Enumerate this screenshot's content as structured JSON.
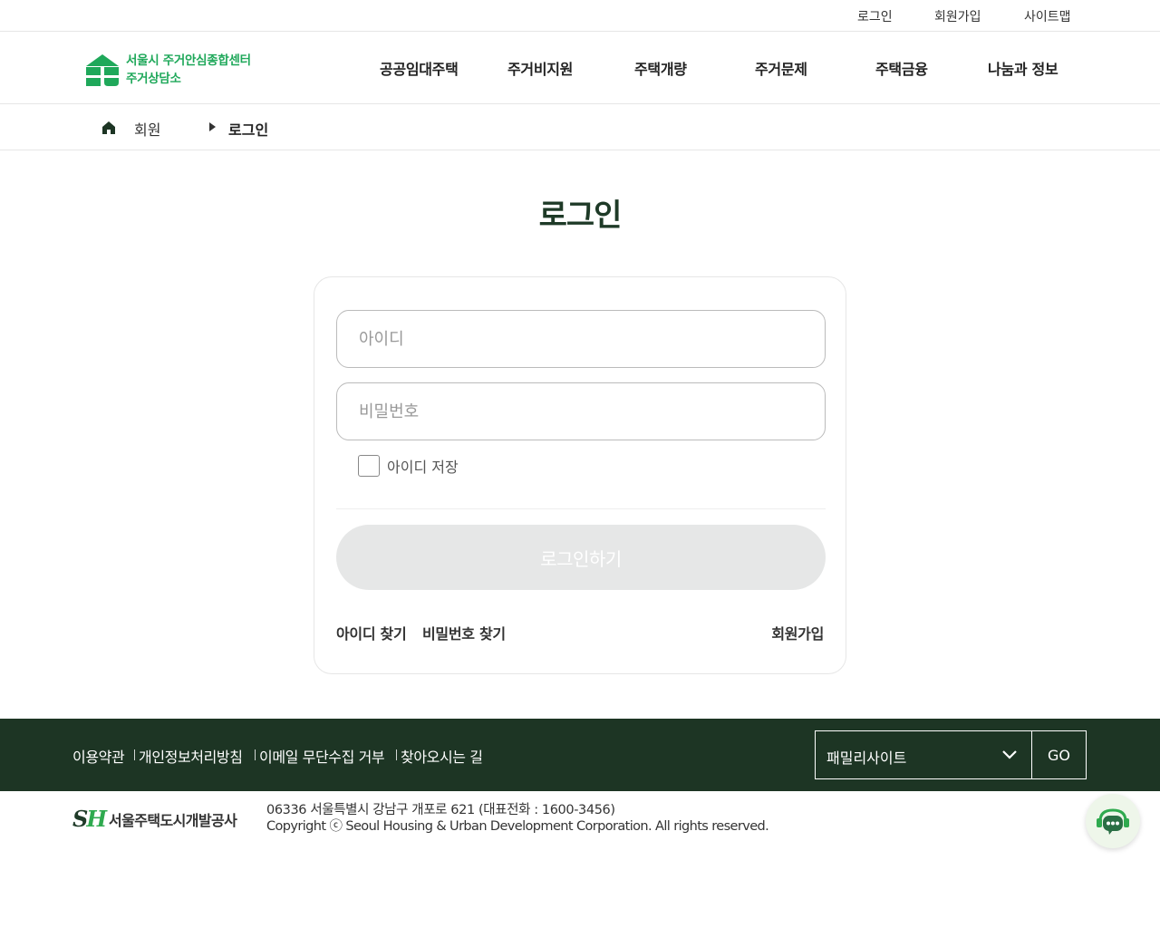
{
  "util_nav": {
    "login": "로그인",
    "signup": "회원가입",
    "sitemap": "사이트맵"
  },
  "logo": {
    "line1": "서울시 주거안심종합센터",
    "line2": "주거상담소"
  },
  "gnb": [
    "공공임대주택",
    "주거비지원",
    "주택개량",
    "주거문제",
    "주택금융",
    "나눔과 정보"
  ],
  "breadcrumb": {
    "parent": "회원",
    "current": "로그인"
  },
  "page_title": "로그인",
  "login_form": {
    "id_placeholder": "아이디",
    "id_value": "",
    "password_placeholder": "비밀번호",
    "password_value": "",
    "remember_label": "아이디 저장",
    "remember_checked": false,
    "submit_label": "로그인하기",
    "find_id": "아이디 찾기",
    "find_password": "비밀번호 찾기",
    "signup": "회원가입"
  },
  "footer": {
    "links": [
      "이용약관",
      "개인정보처리방침",
      "이메일 무단수집 거부",
      "찾아오시는 길"
    ],
    "family_site_label": "패밀리사이트",
    "go_label": "GO",
    "company_name": "서울주택도시개발공사",
    "address": "06336 서울특별시 강남구 개포로 621 (대표전화 : 1600-3456)",
    "copyright": "Copyright ⓒ Seoul Housing & Urban Development Corporation. All rights reserved."
  },
  "colors": {
    "brand_green": "#1fa85a",
    "footer_bg": "#1d3524",
    "title_color": "#1e3a27",
    "button_disabled": "#e6e7e7"
  }
}
